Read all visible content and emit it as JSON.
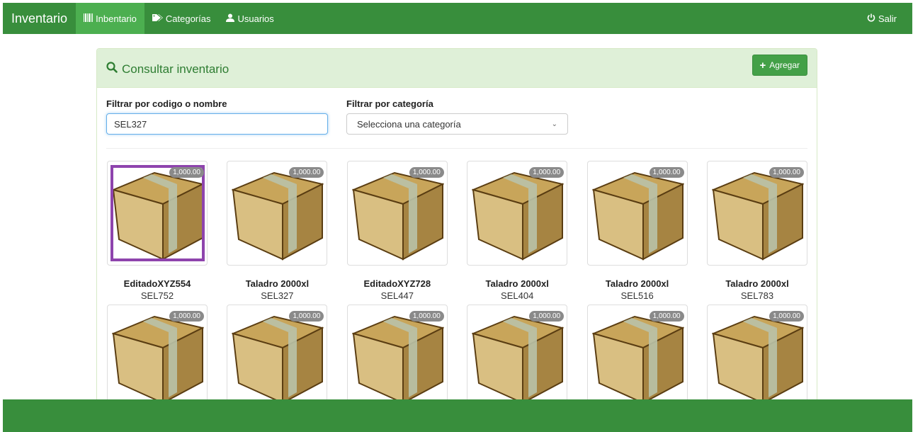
{
  "navbar": {
    "brand": "Inventario",
    "items": [
      {
        "label": "Inbentario",
        "icon": "barcode-icon",
        "active": true
      },
      {
        "label": "Categorías",
        "icon": "tags-icon",
        "active": false
      },
      {
        "label": "Usuarios",
        "icon": "user-icon",
        "active": false
      }
    ],
    "logout_label": "Salir",
    "logout_icon": "power-icon",
    "color": "#388e3c",
    "active_color": "#4caf50"
  },
  "panel": {
    "title": "Consultar inventario",
    "title_icon": "search-icon",
    "add_label": "Agregar",
    "add_icon": "plus-icon"
  },
  "filters": {
    "code_label": "Filtrar por codigo o nombre",
    "code_value": "SEL327",
    "category_label": "Filtrar por categoría",
    "category_value": "Selecciona una categoría"
  },
  "products": [
    {
      "name": "EditadoXYZ554",
      "code": "SEL752",
      "price": "1,000.00",
      "selected": true
    },
    {
      "name": "Taladro 2000xl",
      "code": "SEL327",
      "price": "1,000.00"
    },
    {
      "name": "EditadoXYZ728",
      "code": "SEL447",
      "price": "1,000.00"
    },
    {
      "name": "Taladro 2000xl",
      "code": "SEL404",
      "price": "1,000.00"
    },
    {
      "name": "Taladro 2000xl",
      "code": "SEL516",
      "price": "1,000.00"
    },
    {
      "name": "Taladro 2000xl",
      "code": "SEL783",
      "price": "1,000.00"
    },
    {
      "name": "",
      "code": "",
      "price": "1,000.00"
    },
    {
      "name": "",
      "code": "",
      "price": "1,000.00"
    },
    {
      "name": "",
      "code": "",
      "price": "1,000.00"
    },
    {
      "name": "",
      "code": "",
      "price": "1,000.00"
    },
    {
      "name": "",
      "code": "",
      "price": "1,000.00"
    },
    {
      "name": "",
      "code": "",
      "price": "1,000.00"
    }
  ],
  "colors": {
    "selection": "#8e44ad",
    "price_badge": "#8a8a8a"
  }
}
